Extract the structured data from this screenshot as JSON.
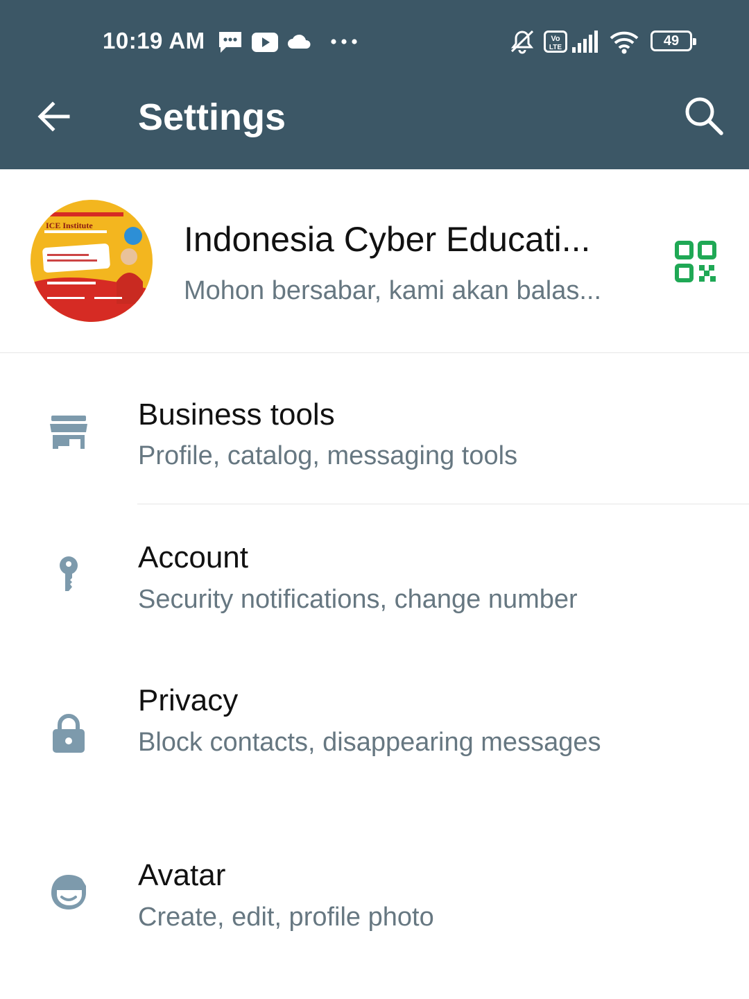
{
  "status_bar": {
    "time": "10:19 AM",
    "battery": "49",
    "network_badge": "Vo LTE",
    "icons": [
      "message-icon",
      "youtube-icon",
      "cloud-icon",
      "more-dots-icon",
      "silent-bell-icon",
      "volte-icon",
      "signal-icon",
      "wifi-icon",
      "battery-icon"
    ]
  },
  "toolbar": {
    "title": "Settings",
    "back_icon": "arrow-back-icon",
    "search_icon": "search-icon"
  },
  "profile": {
    "name": "Indonesia Cyber Educati...",
    "about": "Mohon bersabar, kami akan balas...",
    "photo_text": "ICE Institute",
    "qr_icon": "qr-code-icon"
  },
  "settings_items": [
    {
      "title": "Business tools",
      "subtitle": "Profile, catalog, messaging tools",
      "icon": "store-icon"
    },
    {
      "title": "Account",
      "subtitle": "Security notifications, change number",
      "icon": "key-icon"
    },
    {
      "title": "Privacy",
      "subtitle": "Block contacts, disappearing messages",
      "icon": "lock-icon"
    },
    {
      "title": "Avatar",
      "subtitle": "Create, edit, profile photo",
      "icon": "avatar-face-icon"
    }
  ],
  "colors": {
    "appbar": "#3c5766",
    "accent": "#1fa855",
    "icon_grey": "#7d9aac",
    "subtitle_grey": "#667781"
  }
}
